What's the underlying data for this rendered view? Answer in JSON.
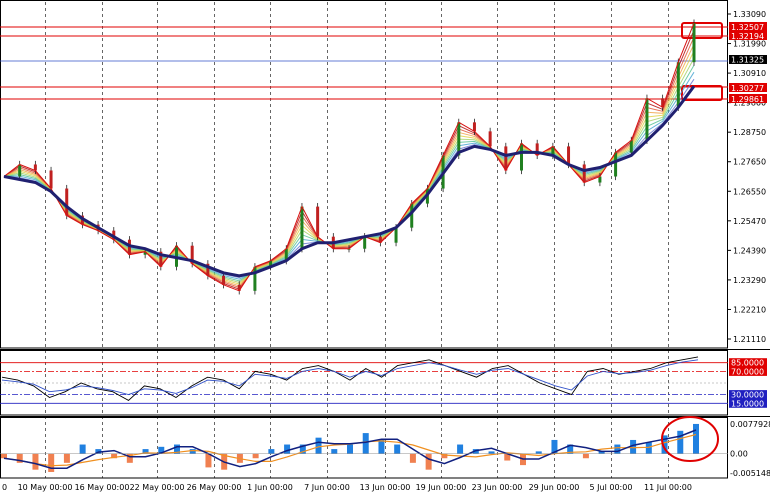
{
  "chart_data": [
    {
      "type": "line",
      "title": "",
      "panel": "price",
      "ylim": [
        1.205,
        1.32
      ],
      "yticks": [
        "1.33090",
        "1.31990",
        "1.30910",
        "1.29860",
        "1.28750",
        "1.27650",
        "1.26550",
        "1.25470",
        "1.24390",
        "1.23290",
        "1.22210",
        "1.21110"
      ],
      "x_ticks": [
        "0",
        "10 May 00:00",
        "16 May 00:00",
        "22 May 00:00",
        "26 May 00:00",
        "1 Jun 00:00",
        "7 Jun 00:00",
        "13 Jun 00:00",
        "19 Jun 00:00",
        "23 Jun 00:00",
        "29 Jun 00:00",
        "5 Jul 00:00",
        "11 Jul 00:00"
      ],
      "current_price_tag": "1.31325",
      "level_tags": [
        "1.32507",
        "1.32194",
        "1.30277",
        "1.29861"
      ],
      "series": [
        {
          "values": [
            1.262,
            1.266,
            1.264,
            1.258,
            1.249,
            1.246,
            1.244,
            1.241,
            1.236,
            1.237,
            1.232,
            1.239,
            1.233,
            1.229,
            1.226,
            1.224,
            1.232,
            1.234,
            1.238,
            1.252,
            1.242,
            1.238,
            1.238,
            1.242,
            1.24,
            1.245,
            1.253,
            1.258,
            1.269,
            1.28,
            1.277,
            1.272,
            1.264,
            1.273,
            1.269,
            1.272,
            1.266,
            1.26,
            1.262,
            1.27,
            1.274,
            1.288,
            1.285,
            1.3,
            1.313
          ]
        },
        {
          "values": [
            1.262,
            1.261,
            1.26,
            1.257,
            1.252,
            1.248,
            1.245,
            1.242,
            1.239,
            1.238,
            1.236,
            1.235,
            1.234,
            1.232,
            1.23,
            1.229,
            1.23,
            1.232,
            1.234,
            1.238,
            1.24,
            1.24,
            1.241,
            1.242,
            1.243,
            1.245,
            1.25,
            1.256,
            1.263,
            1.27,
            1.272,
            1.271,
            1.269,
            1.27,
            1.27,
            1.269,
            1.266,
            1.264,
            1.265,
            1.267,
            1.269,
            1.274,
            1.279,
            1.285,
            1.292
          ]
        }
      ]
    },
    {
      "type": "line",
      "panel": "stochastic",
      "ylim": [
        0,
        100
      ],
      "level_tags": [
        "85.0000",
        "70.0000",
        "30.0000",
        "15.0000"
      ],
      "series": [
        {
          "values": [
            60,
            55,
            45,
            25,
            35,
            50,
            40,
            35,
            20,
            45,
            40,
            25,
            45,
            60,
            55,
            40,
            70,
            65,
            55,
            75,
            80,
            70,
            55,
            75,
            60,
            80,
            85,
            90,
            80,
            70,
            60,
            75,
            80,
            65,
            50,
            40,
            30,
            70,
            75,
            65,
            70,
            75,
            85,
            90,
            95
          ]
        },
        {
          "values": [
            55,
            52,
            48,
            35,
            38,
            45,
            42,
            37,
            30,
            40,
            38,
            32,
            42,
            55,
            53,
            45,
            65,
            62,
            58,
            70,
            75,
            70,
            60,
            70,
            63,
            75,
            80,
            85,
            80,
            72,
            65,
            72,
            75,
            65,
            55,
            45,
            38,
            62,
            70,
            66,
            68,
            72,
            80,
            86,
            90
          ]
        }
      ]
    },
    {
      "type": "bar",
      "panel": "oscillator",
      "ylim": [
        -0.0051,
        0.0078
      ],
      "yticks": [
        "0.0077928",
        "0.00",
        "-0.0051482"
      ],
      "values": [
        -0.001,
        -0.002,
        -0.0035,
        -0.004,
        -0.002,
        0.002,
        0.001,
        -0.001,
        -0.002,
        0.001,
        0.0015,
        0.002,
        0.001,
        -0.003,
        -0.0035,
        -0.002,
        -0.001,
        0.001,
        0.002,
        0.002,
        0.0035,
        0.001,
        0.002,
        0.0045,
        0.003,
        0.002,
        -0.002,
        -0.0035,
        -0.001,
        0.002,
        0.001,
        0.0005,
        -0.0015,
        -0.0025,
        0.0005,
        0.003,
        0.002,
        -0.001,
        0.0005,
        0.002,
        0.003,
        0.0025,
        0.004,
        0.005,
        0.0065
      ]
    }
  ]
}
